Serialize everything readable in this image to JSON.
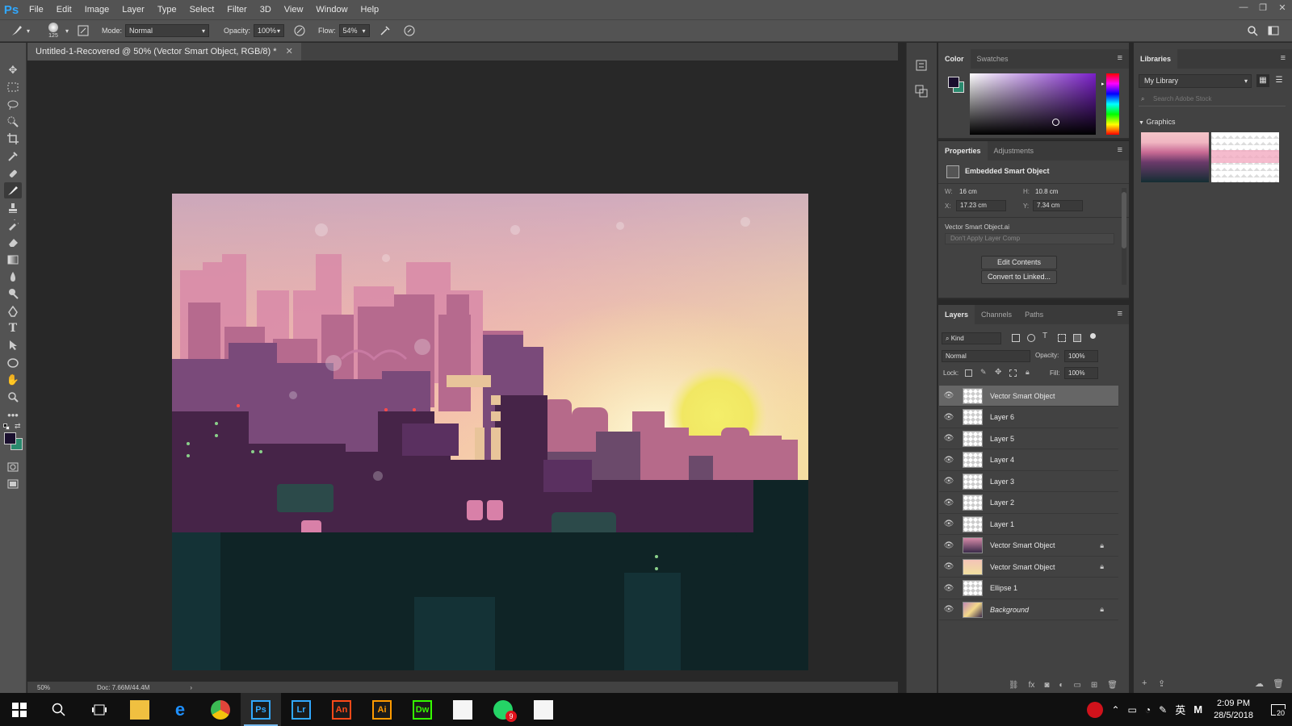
{
  "app": {
    "logo": "Ps"
  },
  "menu": [
    "File",
    "Edit",
    "Image",
    "Layer",
    "Type",
    "Select",
    "Filter",
    "3D",
    "View",
    "Window",
    "Help"
  ],
  "window_controls": [
    "—",
    "❐",
    "✕"
  ],
  "options": {
    "brush_size": "125",
    "mode_label": "Mode:",
    "mode_value": "Normal",
    "opacity_label": "Opacity:",
    "opacity_value": "100%",
    "flow_label": "Flow:",
    "flow_value": "54%"
  },
  "document": {
    "tab_title": "Untitled-1-Recovered @ 50% (Vector Smart Object, RGB/8) *",
    "zoom": "50%",
    "doc_info": "Doc: 7.66M/44.4M"
  },
  "colors": {
    "foreground": "#1a0f2e",
    "background": "#2a8a6e",
    "picker_hue": "#7a1fc8",
    "accent": "#31a8ff"
  },
  "color_panel": {
    "tabs": [
      "Color",
      "Swatches"
    ]
  },
  "libraries_panel": {
    "tab": "Libraries",
    "library_name": "My Library",
    "search_placeholder": "Search Adobe Stock",
    "section": "Graphics"
  },
  "properties_panel": {
    "tabs": [
      "Properties",
      "Adjustments"
    ],
    "object_type": "Embedded Smart Object",
    "w_label": "W:",
    "w_value": "16 cm",
    "h_label": "H:",
    "h_value": "10.8 cm",
    "x_label": "X:",
    "x_value": "17.23 cm",
    "y_label": "Y:",
    "y_value": "7.34 cm",
    "file_name": "Vector Smart Object.ai",
    "layer_comp": "Don't Apply Layer Comp",
    "edit_contents": "Edit Contents",
    "convert_linked": "Convert to Linked..."
  },
  "layers_panel": {
    "tabs": [
      "Layers",
      "Channels",
      "Paths"
    ],
    "filter_kind": "Kind",
    "blend_mode": "Normal",
    "opacity_label": "Opacity:",
    "opacity_value": "100%",
    "lock_label": "Lock:",
    "fill_label": "Fill:",
    "fill_value": "100%",
    "layers": [
      {
        "name": "Vector Smart Object",
        "selected": true,
        "locked": false
      },
      {
        "name": "Layer 6",
        "selected": false,
        "locked": false
      },
      {
        "name": "Layer 5",
        "selected": false,
        "locked": false
      },
      {
        "name": "Layer 4",
        "selected": false,
        "locked": false
      },
      {
        "name": "Layer 3",
        "selected": false,
        "locked": false
      },
      {
        "name": "Layer 2",
        "selected": false,
        "locked": false
      },
      {
        "name": "Layer 1",
        "selected": false,
        "locked": false
      },
      {
        "name": "Vector Smart Object",
        "selected": false,
        "locked": true
      },
      {
        "name": "Vector Smart Object",
        "selected": false,
        "locked": true
      },
      {
        "name": "Ellipse 1",
        "selected": false,
        "locked": false
      },
      {
        "name": "Background",
        "selected": false,
        "locked": true
      }
    ]
  },
  "taskbar": {
    "apps": [
      {
        "name": "File Explorer",
        "label": "",
        "color": "#f0c040"
      },
      {
        "name": "Edge",
        "label": "e",
        "color": "#1e90ff"
      },
      {
        "name": "Chrome",
        "label": "",
        "color": "#e0453a"
      },
      {
        "name": "Photoshop",
        "label": "Ps",
        "color": "#31a8ff"
      },
      {
        "name": "Lightroom",
        "label": "Lr",
        "color": "#31a8ff"
      },
      {
        "name": "Animate",
        "label": "An",
        "color": "#ff4a19"
      },
      {
        "name": "Illustrator",
        "label": "Ai",
        "color": "#ff9a00"
      },
      {
        "name": "Dreamweaver",
        "label": "Dw",
        "color": "#35fa00"
      },
      {
        "name": "Sticky Notes",
        "label": "",
        "color": "#f5f5f5"
      },
      {
        "name": "WhatsApp",
        "label": "",
        "color": "#25d366"
      },
      {
        "name": "Photos",
        "label": "",
        "color": "#f5f5f5"
      }
    ],
    "whatsapp_badge": "9",
    "ime": "英",
    "time": "2:09 PM",
    "date": "28/5/2018",
    "notifications": "20"
  }
}
